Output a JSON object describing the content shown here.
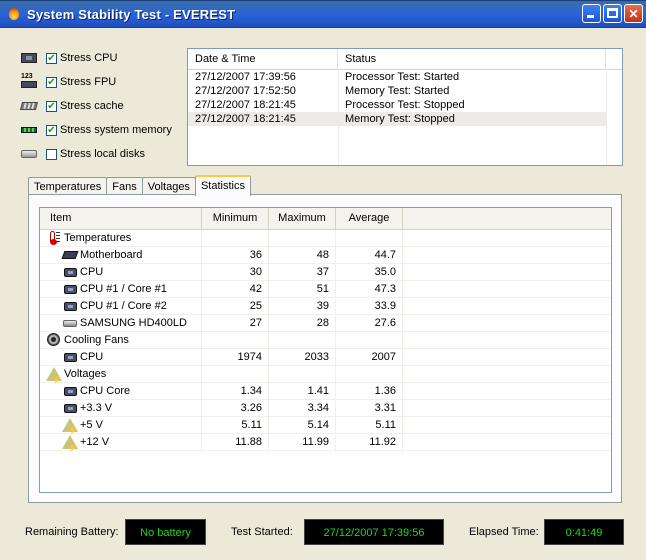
{
  "window": {
    "title": "System Stability Test - EVEREST",
    "icon": "flame-icon"
  },
  "options": [
    {
      "label": "Stress CPU",
      "checked": true,
      "icon": "cpu-icon"
    },
    {
      "label": "Stress FPU",
      "checked": true,
      "icon": "fpu-icon"
    },
    {
      "label": "Stress cache",
      "checked": true,
      "icon": "cache-icon"
    },
    {
      "label": "Stress system memory",
      "checked": true,
      "icon": "memory-icon"
    },
    {
      "label": "Stress local disks",
      "checked": false,
      "icon": "disk-icon"
    }
  ],
  "log": {
    "columns": [
      "Date & Time",
      "Status"
    ],
    "rows": [
      {
        "time": "27/12/2007 17:39:56",
        "status": "Processor Test: Started"
      },
      {
        "time": "27/12/2007 17:52:50",
        "status": "Memory Test: Started"
      },
      {
        "time": "27/12/2007 18:21:45",
        "status": "Processor Test: Stopped"
      },
      {
        "time": "27/12/2007 18:21:45",
        "status": "Memory Test: Stopped"
      }
    ]
  },
  "tabs": [
    "Temperatures",
    "Fans",
    "Voltages",
    "Statistics"
  ],
  "active_tab": "Statistics",
  "stats": {
    "columns": [
      "Item",
      "Minimum",
      "Maximum",
      "Average"
    ],
    "rows": [
      {
        "item": "Temperatures",
        "min": "",
        "max": "",
        "avg": "",
        "group": true,
        "icon": "thermometer-icon"
      },
      {
        "item": "Motherboard",
        "min": "36",
        "max": "48",
        "avg": "44.7",
        "group": false,
        "icon": "motherboard-icon"
      },
      {
        "item": "CPU",
        "min": "30",
        "max": "37",
        "avg": "35.0",
        "group": false,
        "icon": "cpu-icon"
      },
      {
        "item": "CPU #1 / Core #1",
        "min": "42",
        "max": "51",
        "avg": "47.3",
        "group": false,
        "icon": "cpu-icon"
      },
      {
        "item": "CPU #1 / Core #2",
        "min": "25",
        "max": "39",
        "avg": "33.9",
        "group": false,
        "icon": "cpu-icon"
      },
      {
        "item": "SAMSUNG HD400LD",
        "min": "27",
        "max": "28",
        "avg": "27.6",
        "group": false,
        "icon": "hard-disk-icon"
      },
      {
        "item": "Cooling Fans",
        "min": "",
        "max": "",
        "avg": "",
        "group": true,
        "icon": "fan-icon"
      },
      {
        "item": "CPU",
        "min": "1974",
        "max": "2033",
        "avg": "2007",
        "group": false,
        "icon": "cpu-icon"
      },
      {
        "item": "Voltages",
        "min": "",
        "max": "",
        "avg": "",
        "group": true,
        "icon": "voltage-icon"
      },
      {
        "item": "CPU Core",
        "min": "1.34",
        "max": "1.41",
        "avg": "1.36",
        "group": false,
        "icon": "cpu-icon"
      },
      {
        "item": "+3.3 V",
        "min": "3.26",
        "max": "3.34",
        "avg": "3.31",
        "group": false,
        "icon": "cpu-icon"
      },
      {
        "item": "+5 V",
        "min": "5.11",
        "max": "5.14",
        "avg": "5.11",
        "group": false,
        "icon": "voltage-icon"
      },
      {
        "item": "+12 V",
        "min": "11.88",
        "max": "11.99",
        "avg": "11.92",
        "group": false,
        "icon": "voltage-icon"
      }
    ]
  },
  "status": {
    "battery_label": "Remaining Battery:",
    "battery_value": "No battery",
    "started_label": "Test Started:",
    "started_value": "27/12/2007 17:39:56",
    "elapsed_label": "Elapsed Time:",
    "elapsed_value": "0:41:49",
    "led_color": "#21d421"
  }
}
